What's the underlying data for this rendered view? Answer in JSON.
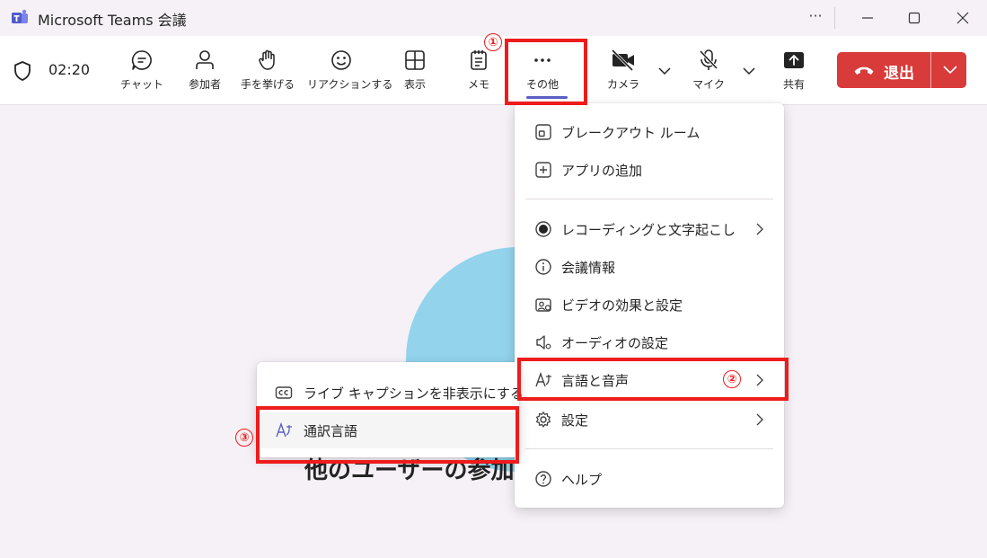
{
  "window": {
    "title": "Microsoft Teams 会議",
    "more_glyph": "···"
  },
  "toolbar": {
    "timer": "02:20",
    "items": [
      {
        "label": "チャット",
        "icon": "chat-icon"
      },
      {
        "label": "参加者",
        "icon": "people-icon"
      },
      {
        "label": "手を挙げる",
        "icon": "raise-hand-icon"
      },
      {
        "label": "リアクションする",
        "icon": "emoji-icon"
      },
      {
        "label": "表示",
        "icon": "view-grid-icon"
      },
      {
        "label": "メモ",
        "icon": "notes-icon"
      },
      {
        "label": "その他",
        "icon": "more-icon"
      },
      {
        "label": "カメラ",
        "icon": "camera-off-icon"
      },
      {
        "label": "マイク",
        "icon": "mic-off-icon"
      },
      {
        "label": "共有",
        "icon": "share-icon"
      }
    ],
    "leave_label": "退出",
    "leave_color": "#d93a3a"
  },
  "stage": {
    "text": "他のユーザーの参加を"
  },
  "more_menu": {
    "items": [
      {
        "label": "ブレークアウト ルーム",
        "icon": "breakout-rooms-icon"
      },
      {
        "label": "アプリの追加",
        "icon": "add-app-icon"
      },
      {
        "label": "レコーディングと文字起こし",
        "icon": "record-icon"
      },
      {
        "label": "会議情報",
        "icon": "info-icon"
      },
      {
        "label": "ビデオの効果と設定",
        "icon": "video-effects-icon"
      },
      {
        "label": "オーディオの設定",
        "icon": "speaker-settings-icon"
      },
      {
        "label": "言語と音声",
        "icon": "language-icon"
      },
      {
        "label": "設定",
        "icon": "gear-icon"
      },
      {
        "label": "ヘルプ",
        "icon": "help-icon"
      }
    ]
  },
  "language_submenu": {
    "items": [
      {
        "label": "ライブ キャプションを非表示にする",
        "icon": "closed-caption-icon"
      },
      {
        "label": "通訳言語",
        "icon": "language-icon"
      }
    ]
  },
  "annotations": {
    "step1": "①",
    "step2": "②",
    "step3": "③",
    "color": "#ee1c1c"
  }
}
